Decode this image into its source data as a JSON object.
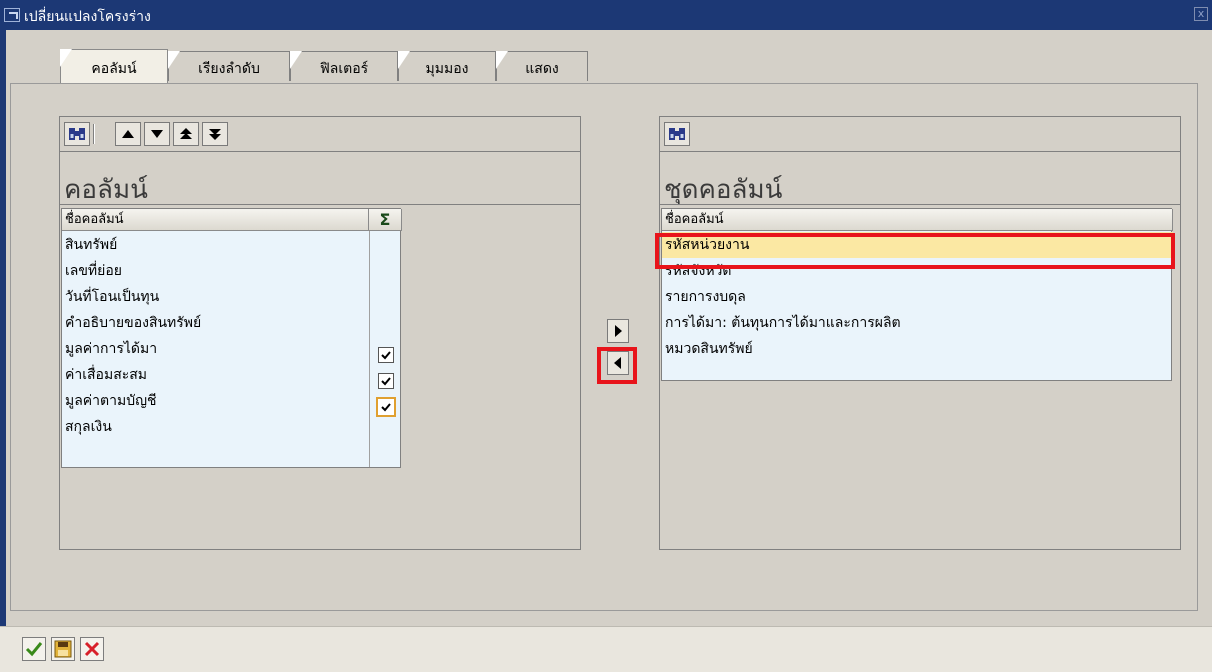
{
  "window": {
    "title": "เปลี่ยนแปลงโครงร่าง",
    "close_symbol": "x"
  },
  "tabs": [
    {
      "label": "คอลัมน์",
      "active": true
    },
    {
      "label": "เรียงลำดับ",
      "active": false
    },
    {
      "label": "ฟิลเตอร์",
      "active": false
    },
    {
      "label": "มุมมอง",
      "active": false
    },
    {
      "label": "แสดง",
      "active": false
    }
  ],
  "left_panel": {
    "title": "คอลัมน์",
    "column_header": "ชื่อคอลัมน์",
    "sum_header": "Σ",
    "toolbar_icons": [
      "find-icon",
      "move-up-icon",
      "move-down-icon",
      "move-top-icon",
      "move-bottom-icon"
    ],
    "rows": [
      {
        "label": "สินทรัพย์",
        "sum_checkbox": false
      },
      {
        "label": "เลขที่ย่อย",
        "sum_checkbox": false
      },
      {
        "label": "วันที่โอนเป็นทุน",
        "sum_checkbox": false
      },
      {
        "label": "คำอธิบายของสินทรัพย์",
        "sum_checkbox": false
      },
      {
        "label": "มูลค่าการได้มา",
        "sum_checkbox": true,
        "checked": true
      },
      {
        "label": "ค่าเสื่อมสะสม",
        "sum_checkbox": true,
        "checked": true
      },
      {
        "label": "มูลค่าตามบัญชี",
        "sum_checkbox": true,
        "checked": true,
        "focused": true
      },
      {
        "label": "สกุลเงิน",
        "sum_checkbox": false
      }
    ]
  },
  "right_panel": {
    "title": "ชุดคอลัมน์",
    "column_header": "ชื่อคอลัมน์",
    "toolbar_icons": [
      "find-icon"
    ],
    "rows": [
      {
        "label": "รหัสหน่วยงาน",
        "selected": true
      },
      {
        "label": "รหัสจังหวัด",
        "selected": false
      },
      {
        "label": "รายการงบดุล",
        "selected": false
      },
      {
        "label": "การได้มา: ต้นทุนการได้มาและการผลิต",
        "selected": false
      },
      {
        "label": "หมวดสินทรัพย์",
        "selected": false
      }
    ]
  },
  "transfer_buttons": [
    "add-to-displayed-icon",
    "remove-from-displayed-icon"
  ],
  "bottom_buttons": [
    "confirm-icon",
    "save-icon",
    "cancel-icon"
  ],
  "colors": {
    "title_bar": "#1c3875",
    "window_bg": "#d4d0c8",
    "list_bg": "#eaf4fb",
    "selected_row": "#fbe8a3",
    "highlight_box": "#e8141b",
    "confirm": "#3a8a1a",
    "save": "#b8860b",
    "cancel": "#d8202a"
  }
}
